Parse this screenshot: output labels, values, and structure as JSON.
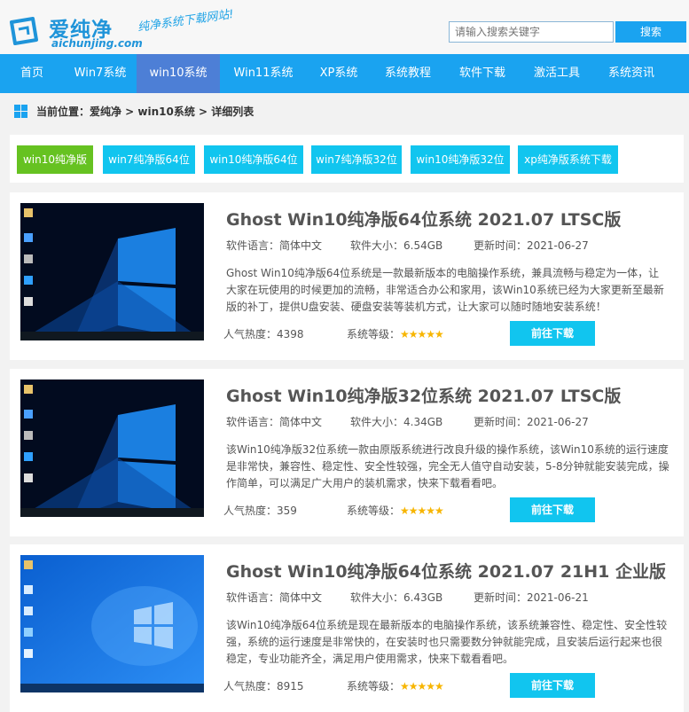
{
  "header": {
    "logo_cn": "爱纯净",
    "logo_en": "aichunjing.com",
    "slogan": "纯净系统下载网站!",
    "search_placeholder": "请输入搜索关键字",
    "search_button": "搜索"
  },
  "nav": [
    {
      "label": "首页"
    },
    {
      "label": "Win7系统"
    },
    {
      "label": "win10系统",
      "active": true
    },
    {
      "label": "Win11系统"
    },
    {
      "label": "XP系统"
    },
    {
      "label": "系统教程"
    },
    {
      "label": "软件下载"
    },
    {
      "label": "激活工具"
    },
    {
      "label": "系统资讯"
    }
  ],
  "breadcrumb": "当前位置：爱纯净 > win10系统 > 详细列表",
  "tags": [
    {
      "label": "win10纯净版",
      "active": true
    },
    {
      "label": "win7纯净版64位"
    },
    {
      "label": "win10纯净版64位"
    },
    {
      "label": "win7纯净版32位"
    },
    {
      "label": "win10纯净版32位"
    },
    {
      "label": "xp纯净版系统下载"
    }
  ],
  "items": [
    {
      "title": "Ghost Win10纯净版64位系统 2021.07 LTSC版",
      "language": "软件语言：简体中文",
      "size": "软件大小：6.54GB",
      "updated": "更新时间：2021-06-27",
      "description": "Ghost Win10纯净版64位系统是一款最新版本的电脑操作系统，兼具流畅与稳定为一体，让大家在玩使用的时候更加的流畅，非常适合办公和家用，该Win10系统已经为大家更新至最新版的补丁，提供U盘安装、硬盘安装等装机方式，让大家可以随时随地安装系统！",
      "popularity": "人气热度：4398",
      "rating_label": "系统等级：",
      "rating": 5,
      "rating_stars": "★★★★★",
      "download": "前往下载",
      "wallpaper": "dark"
    },
    {
      "title": "Ghost Win10纯净版32位系统 2021.07 LTSC版",
      "language": "软件语言：简体中文",
      "size": "软件大小：4.34GB",
      "updated": "更新时间：2021-06-27",
      "description": "该Win10纯净版32位系统一款由原版系统进行改良升级的操作系统，该Win10系统的运行速度是非常快，兼容性、稳定性、安全性较强，完全无人值守自动安装，5-8分钟就能安装完成，操作简单，可以满足广大用户的装机需求，快来下载看看吧。",
      "popularity": "人气热度：359",
      "rating_label": "系统等级：",
      "rating": 5,
      "rating_stars": "★★★★★",
      "download": "前往下载",
      "wallpaper": "dark"
    },
    {
      "title": "Ghost Win10纯净版64位系统 2021.07 21H1 企业版",
      "language": "软件语言：简体中文",
      "size": "软件大小：6.43GB",
      "updated": "更新时间：2021-06-21",
      "description": "该Win10纯净版64位系统是现在最新版本的电脑操作系统，该系统兼容性、稳定性、安全性较强，系统的运行速度是非常快的，在安装时也只需要数分钟就能完成，且安装后运行起来也很稳定，专业功能齐全，满足用户使用需求，快来下载看看吧。",
      "popularity": "人气热度：8915",
      "rating_label": "系统等级：",
      "rating": 5,
      "rating_stars": "★★★★★",
      "download": "前往下载",
      "wallpaper": "light"
    }
  ],
  "colors": {
    "accent": "#1aa3f0",
    "nav_active": "#4d7fd6",
    "tag": "#11c5ef",
    "tag_active": "#66c221",
    "star": "#f7b500"
  }
}
